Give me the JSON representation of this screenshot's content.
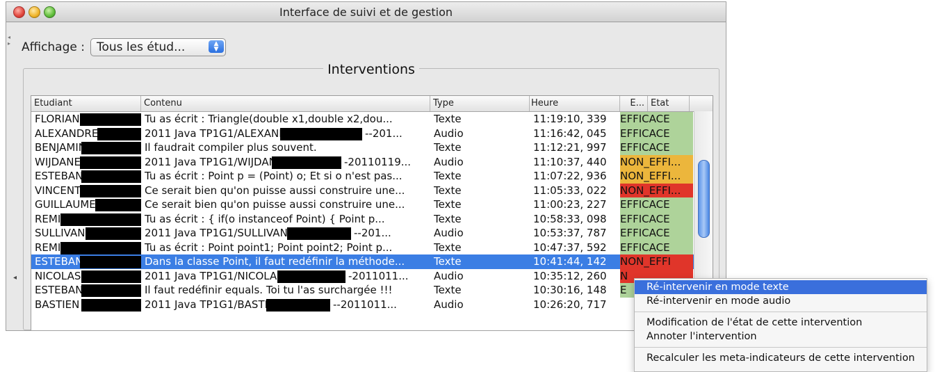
{
  "window": {
    "title": "Interface de suivi et de gestion"
  },
  "toolbar": {
    "display_label": "Affichage :",
    "display_value": "Tous les étud..."
  },
  "group": {
    "title": "Interventions"
  },
  "table": {
    "columns": [
      "Etudiant",
      "Contenu",
      "Type",
      "Heure",
      "E...",
      "Etat"
    ],
    "rows": [
      {
        "etudiant": "FLORIAN",
        "contenu": "Tu as écrit :  Triangle(double x1,double x2,dou...",
        "type": "Texte",
        "heure": "11:19:10, 339",
        "etat": "EFFICACE",
        "etat_color": "#aed39a"
      },
      {
        "etudiant": "ALEXANDRE",
        "contenu": "2011 Java TP1G1/ALEXANDRE",
        "contenu_tail": "--201...",
        "type": "Audio",
        "heure": "11:16:42, 045",
        "etat": "EFFICACE",
        "etat_color": "#aed39a"
      },
      {
        "etudiant": "BENJAMIN",
        "contenu": "Il faudrait compiler plus souvent.",
        "type": "Texte",
        "heure": "11:12:21, 997",
        "etat": "EFFICACE",
        "etat_color": "#aed39a"
      },
      {
        "etudiant": "WIJDANE",
        "contenu": "2011 Java TP1G1/WIJDANE",
        "contenu_tail": "-20110119...",
        "type": "Audio",
        "heure": "11:10:37, 440",
        "etat": "NON_EFFI...",
        "etat_color": "#ecb63c"
      },
      {
        "etudiant": "ESTEBAN",
        "contenu": "Tu as écrit : Point p = (Point) o;  Et si o n'est pas...",
        "type": "Texte",
        "heure": "11:07:22, 936",
        "etat": "NON_EFFI...",
        "etat_color": "#ecb63c"
      },
      {
        "etudiant": "VINCENT",
        "contenu": "Ce serait bien qu'on puisse aussi construire une...",
        "type": "Texte",
        "heure": "11:05:33, 022",
        "etat": "NON_EFFI...",
        "etat_color": "#e0352a"
      },
      {
        "etudiant": "GUILLAUME",
        "contenu": "Ce serait bien qu'on puisse aussi construire une...",
        "type": "Texte",
        "heure": "11:00:23, 227",
        "etat": "EFFICACE",
        "etat_color": "#aed39a"
      },
      {
        "etudiant": "REMI",
        "contenu": "Tu as écrit :  {   if(o instanceof Point)  {    Point p...",
        "type": "Texte",
        "heure": "10:58:33, 098",
        "etat": "EFFICACE",
        "etat_color": "#aed39a"
      },
      {
        "etudiant": "SULLIVANE",
        "contenu": "2011 Java TP1G1/SULLIVANE",
        "contenu_tail": "--201...",
        "type": "Audio",
        "heure": "10:53:37, 787",
        "etat": "EFFICACE",
        "etat_color": "#aed39a"
      },
      {
        "etudiant": "REMI",
        "contenu": "Tu as écrit :  Point point1;  Point point2;  Point p...",
        "type": "Texte",
        "heure": "10:47:37, 592",
        "etat": "EFFICACE",
        "etat_color": "#aed39a"
      },
      {
        "etudiant": "ESTEBAN",
        "contenu": "Dans la classe Point, il faut redéfinir la méthode...",
        "type": "Texte",
        "heure": "10:41:44, 142",
        "etat": "NON_EFFI",
        "etat_color": "#e0352a",
        "selected": true
      },
      {
        "etudiant": "NICOLAS",
        "contenu": "2011 Java TP1G1/NICOLAS",
        "contenu_tail": "-2011011...",
        "type": "Audio",
        "heure": "10:35:12, 260",
        "etat": "N",
        "etat_color": "#e0352a"
      },
      {
        "etudiant": "ESTEBAN",
        "contenu": "Il faut redéfinir equals. Toi tu l'as surchargée !!!",
        "type": "Texte",
        "heure": "10:30:16, 148",
        "etat": "E",
        "etat_color": "#aed39a"
      },
      {
        "etudiant": "BASTIEN",
        "contenu": "2011 Java TP1G1/BASTIEN",
        "contenu_tail": "--2011011...",
        "type": "Audio",
        "heure": "10:26:20, 717",
        "etat": "",
        "etat_color": "#ffffff"
      }
    ]
  },
  "context_menu": {
    "items": [
      "Ré-intervenir en mode texte",
      "Ré-intervenir en mode audio",
      "Modification de l'état de cette intervention",
      "Annoter l'intervention",
      "Recalculer les meta-indicateurs de cette intervention"
    ]
  }
}
